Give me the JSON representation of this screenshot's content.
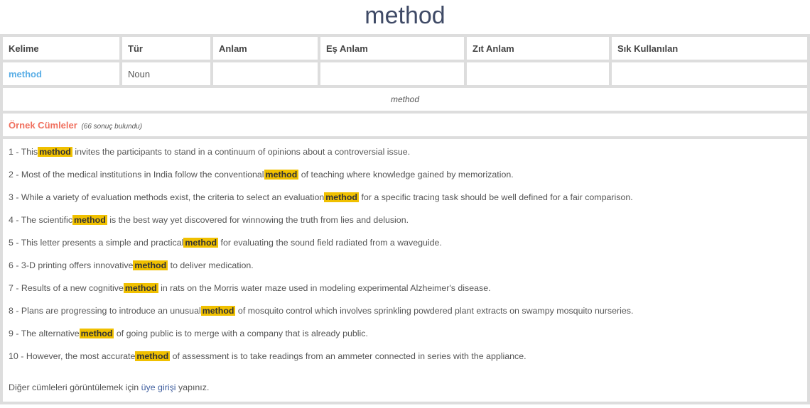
{
  "page": {
    "title": "method"
  },
  "table": {
    "headers": [
      "Kelime",
      "Tür",
      "Anlam",
      "Eş Anlam",
      "Zıt Anlam",
      "Sık Kullanılan"
    ],
    "row": {
      "word": "method",
      "type": "Noun",
      "meaning": "",
      "synonym": "",
      "antonym": "",
      "frequent": ""
    },
    "meaning_text": "method"
  },
  "examples": {
    "title": "Örnek Cümleler",
    "count_text": "(66 sonuç bulundu)",
    "highlight_color": "#f0c000",
    "sentences": [
      {
        "num": "1",
        "before": "This",
        "word": "method",
        "after": "invites the participants to stand in a continuum of opinions about a controversial issue."
      },
      {
        "num": "2",
        "before": "Most of the medical institutions in India follow the conventional",
        "word": "method",
        "after": "of teaching where knowledge gained by memorization."
      },
      {
        "num": "3",
        "before": "While a variety of evaluation methods exist, the criteria to select an evaluation",
        "word": "method",
        "after": "for a specific tracing task should be well defined for a fair comparison."
      },
      {
        "num": "4",
        "before": "The scientific",
        "word": "method",
        "after": "is the best way yet discovered for winnowing the truth from lies and delusion."
      },
      {
        "num": "5",
        "before": "This letter presents a simple and practical",
        "word": "method",
        "after": "for evaluating the sound field radiated from a waveguide."
      },
      {
        "num": "6",
        "before": "3-D printing offers innovative",
        "word": "method",
        "after": "to deliver medication."
      },
      {
        "num": "7",
        "before": "Results of a new cognitive",
        "word": "method",
        "after": "in rats on the Morris water maze used in modeling experimental Alzheimer's disease."
      },
      {
        "num": "8",
        "before": "Plans are progressing to introduce an unusual",
        "word": "method",
        "after": "of mosquito control which involves sprinkling powdered plant extracts on swampy mosquito nurseries."
      },
      {
        "num": "9",
        "before": "The alternative",
        "word": "method",
        "after": "of going public is to merge with a company that is already public."
      },
      {
        "num": "10",
        "before": "However, the most accurate",
        "word": "method",
        "after": "of assessment is to take readings from an ammeter connected in series with the appliance."
      }
    ],
    "login_prefix": "Diğer cümleleri görüntülemek için",
    "login_link": "üye girişi",
    "login_suffix": "yapınız."
  }
}
